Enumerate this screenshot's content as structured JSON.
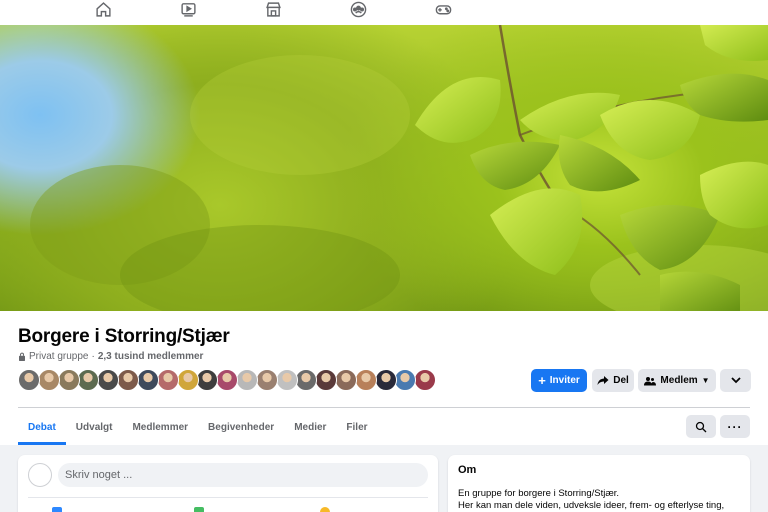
{
  "nav": {
    "icons": [
      "home-icon",
      "watch-icon",
      "marketplace-icon",
      "groups-icon",
      "gaming-icon"
    ]
  },
  "group": {
    "name": "Borgere i Storring/Stjær",
    "privacy": "Privat gruppe",
    "separator": "·",
    "members_count": "2,3 tusind medlemmer"
  },
  "buttons": {
    "invite": "Inviter",
    "share": "Del",
    "member": "Medlem"
  },
  "tabs": [
    "Debat",
    "Udvalgt",
    "Medlemmer",
    "Begivenheder",
    "Medier",
    "Filer"
  ],
  "active_tab": "Debat",
  "composer": {
    "placeholder": "Skriv noget ..."
  },
  "about": {
    "title": "Om",
    "line1": "En gruppe for borgere i Storring/Stjær.",
    "line2": "Her kan man dele viden, udveksle ideer, frem- og efterlyse ting,"
  },
  "colors": {
    "accent": "#1877f2",
    "avatars": [
      "#6b6b6b",
      "#a88866",
      "#8a7a5c",
      "#5d6b50",
      "#4a4a4a",
      "#7d5a4a",
      "#3e4a5c",
      "#b56a6a",
      "#d0a63a",
      "#3e3e3e",
      "#a84a6a",
      "#b8b8b8",
      "#9a8070",
      "#c0c0c0",
      "#6a6a6a",
      "#5a3a3a",
      "#8a6a5a",
      "#b8805a",
      "#2a2a3a",
      "#4a7ab0",
      "#9a3a4a"
    ]
  }
}
